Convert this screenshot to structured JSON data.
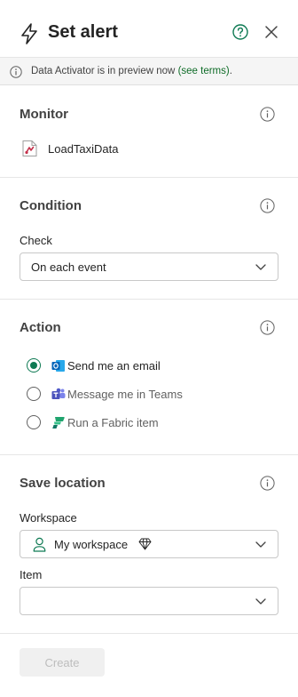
{
  "header": {
    "title": "Set alert"
  },
  "banner": {
    "text": "Data Activator is in preview now",
    "link_text": "(see terms)",
    "trailing": "."
  },
  "monitor": {
    "title": "Monitor",
    "item_name": "LoadTaxiData"
  },
  "condition": {
    "title": "Condition",
    "check_label": "Check",
    "check_value": "On each event"
  },
  "action": {
    "title": "Action",
    "options": [
      {
        "label": "Send me an email",
        "selected": true,
        "icon": "outlook-icon"
      },
      {
        "label": "Message me in Teams",
        "selected": false,
        "icon": "teams-icon"
      },
      {
        "label": "Run a Fabric item",
        "selected": false,
        "icon": "fabric-icon"
      }
    ]
  },
  "save_location": {
    "title": "Save location",
    "workspace_label": "Workspace",
    "workspace_value": "My workspace",
    "item_label": "Item",
    "item_value": ""
  },
  "footer": {
    "create_label": "Create"
  },
  "colors": {
    "accent": "#0e7a53",
    "link": "#0f6c28",
    "banner_bg": "#f5f5f5",
    "disabled_button_bg": "#f0f0f0"
  }
}
